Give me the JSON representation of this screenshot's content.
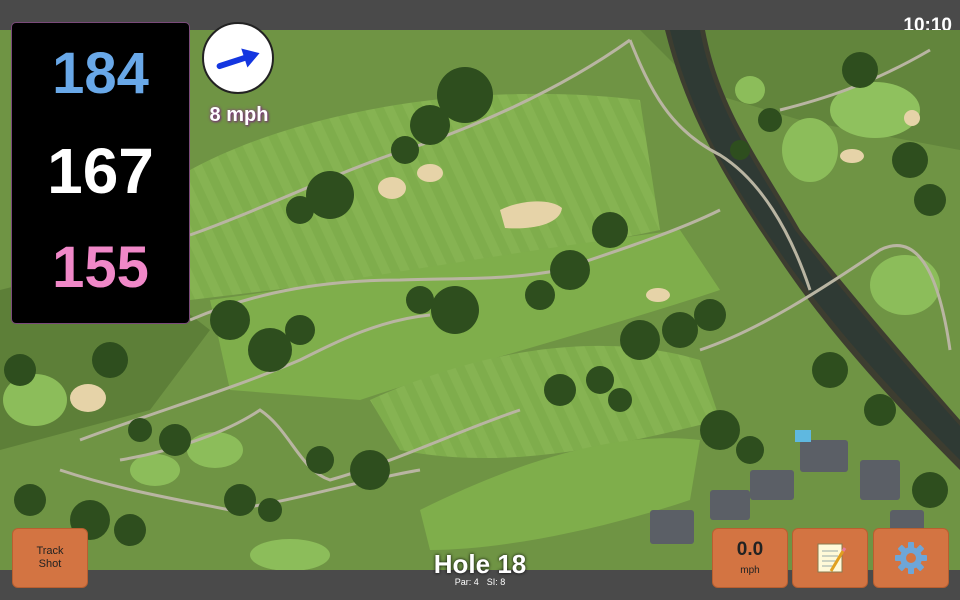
{
  "status": {
    "time": "10:10"
  },
  "distances": {
    "back": "184",
    "middle": "167",
    "front": "155",
    "back_color": "#69a8e8",
    "middle_color": "#ffffff",
    "front_color": "#f088c8"
  },
  "wind": {
    "speed": "8 mph",
    "arrow_icon": "wind-direction-arrow-icon"
  },
  "buttons": {
    "track_shot_line1": "Track",
    "track_shot_line2": "Shot",
    "speed_value": "0.0",
    "speed_unit": "mph",
    "notes_icon": "notepad-icon",
    "settings_icon": "gear-icon",
    "accent_color": "#d37442"
  },
  "hole": {
    "title": "Hole 18",
    "par": "Par: 4",
    "si": "SI: 8"
  }
}
